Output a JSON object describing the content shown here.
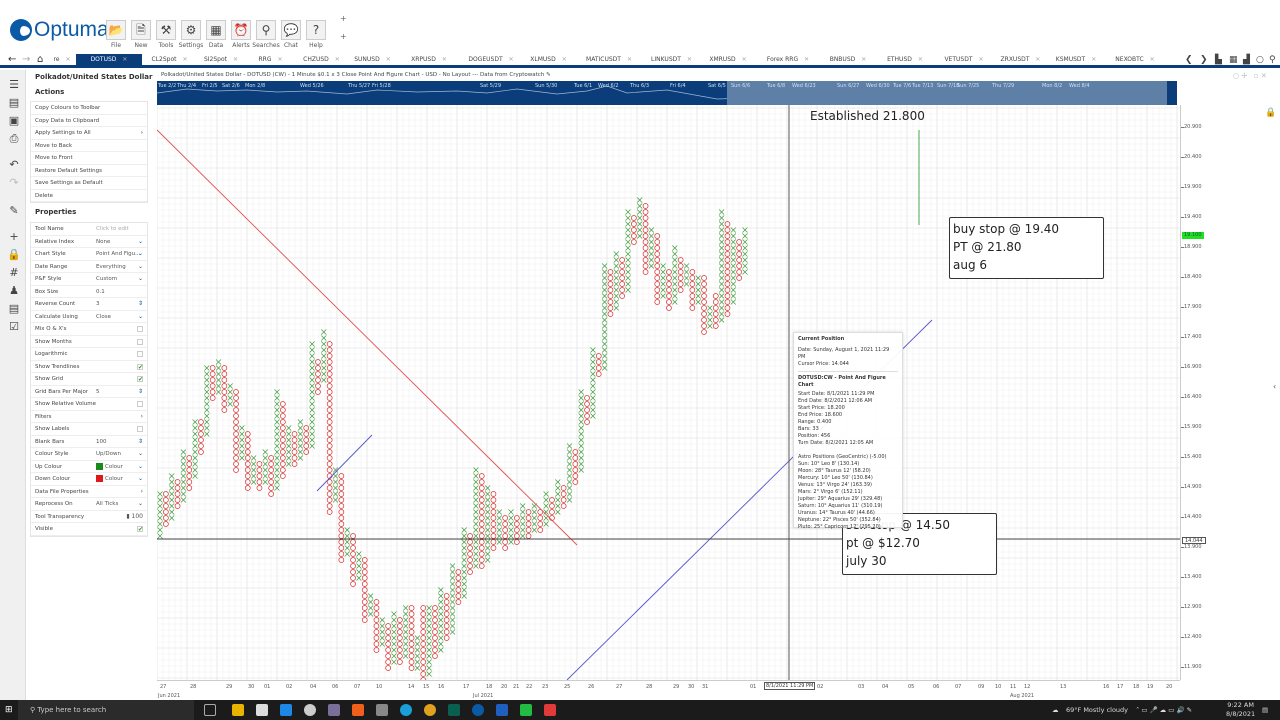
{
  "app": {
    "logo": "Optuma",
    "toolbar": [
      {
        "label": "File",
        "icon": "folder-icon",
        "glyph": "📂"
      },
      {
        "label": "New",
        "icon": "new-document-icon",
        "glyph": "🗎"
      },
      {
        "label": "Tools",
        "icon": "tools-icon",
        "glyph": "⚒"
      },
      {
        "label": "Settings",
        "icon": "gears-icon",
        "glyph": "⚙"
      },
      {
        "label": "Data",
        "icon": "binary-data-icon",
        "glyph": "▦"
      },
      {
        "label": "Alerts",
        "icon": "alarm-clock-icon",
        "glyph": "⏰"
      },
      {
        "label": "Searches",
        "icon": "magnifier-icon",
        "glyph": "⚲"
      },
      {
        "label": "Chat",
        "icon": "chat-bubbles-icon",
        "glyph": "💬"
      },
      {
        "label": "Help",
        "icon": "help-icon",
        "glyph": "?"
      }
    ],
    "plus_glyph": "+"
  },
  "tabs": [
    {
      "label": "re"
    },
    {
      "label": "DOTUSD",
      "active": true
    },
    {
      "label": "CL2Spot"
    },
    {
      "label": "SI2Spot"
    },
    {
      "label": "RRG"
    },
    {
      "label": "CHZUSD"
    },
    {
      "label": "SUNUSD"
    },
    {
      "label": "XRPUSD"
    },
    {
      "label": "DOGEUSDT"
    },
    {
      "label": "XLMUSD"
    },
    {
      "label": "MATICUSDT"
    },
    {
      "label": "LINKUSDT"
    },
    {
      "label": "XMRUSD"
    },
    {
      "label": "Forex RRG"
    },
    {
      "label": "BNBUSD"
    },
    {
      "label": "ETHUSD"
    },
    {
      "label": "VETUSDT"
    },
    {
      "label": "ZRXUSDT"
    },
    {
      "label": "KSMUSDT"
    },
    {
      "label": "NEXOBTC"
    }
  ],
  "tab_close_glyph": "✕",
  "nav": {
    "back": "←",
    "forward": "→",
    "home": "⌂",
    "tabs_left": "❮",
    "tabs_right": "❯"
  },
  "panel": {
    "title": "Polkadot/United States Dollar - DOTUSD",
    "actions_heading": "Actions",
    "actions": [
      {
        "label": "Copy Colours to Toolbar"
      },
      {
        "label": "Copy Data to Clipboard"
      },
      {
        "label": "Apply Settings to All",
        "submenu": true
      },
      {
        "label": "Move to Back"
      },
      {
        "label": "Move to Front"
      },
      {
        "label": "Restore Default Settings"
      },
      {
        "label": "Save Settings as Default"
      },
      {
        "label": "Delete"
      }
    ],
    "properties_heading": "Properties",
    "properties": [
      {
        "key": "Tool Name",
        "value": "Click to edit",
        "control": "text"
      },
      {
        "key": "Relative Index",
        "value": "None",
        "control": "dropdown"
      },
      {
        "key": "Chart Style",
        "value": "Point And Figu...",
        "control": "dropdown"
      },
      {
        "key": "Date Range",
        "value": "Everything",
        "control": "dropdown"
      },
      {
        "key": "P&F Style",
        "value": "Custom",
        "control": "dropdown"
      },
      {
        "key": "Box Size",
        "value": "0.1",
        "control": "text"
      },
      {
        "key": "Reverse Count",
        "value": "3",
        "control": "spinner"
      },
      {
        "key": "Calculate Using",
        "value": "Close",
        "control": "dropdown"
      },
      {
        "key": "Mix O & X's",
        "value": "",
        "control": "checkbox",
        "checked": false
      },
      {
        "key": "Show Months",
        "value": "",
        "control": "checkbox",
        "checked": false
      },
      {
        "key": "Logarithmic",
        "value": "",
        "control": "checkbox",
        "checked": false
      },
      {
        "key": "Show Trendlines",
        "value": "",
        "control": "checkbox",
        "checked": true
      },
      {
        "key": "Show Grid",
        "value": "",
        "control": "checkbox",
        "checked": true
      },
      {
        "key": "Grid Bars Per Major",
        "value": "5",
        "control": "spinner"
      },
      {
        "key": "Show Relative Volume",
        "value": "",
        "control": "checkbox",
        "checked": false
      },
      {
        "key": "Filters",
        "value": "",
        "control": "submenu"
      },
      {
        "key": "Show Labels",
        "value": "",
        "control": "checkbox",
        "checked": false
      },
      {
        "key": "Blank Bars",
        "value": "100",
        "control": "spinner"
      },
      {
        "key": "Colour Style",
        "value": "Up/Down",
        "control": "dropdown"
      },
      {
        "key": "Up Colour",
        "value": "Colour",
        "control": "color",
        "color": "#1a8a1a"
      },
      {
        "key": "Down Colour",
        "value": "Colour",
        "control": "color",
        "color": "#e01818"
      },
      {
        "key": "Data File Properties",
        "value": "",
        "control": "submenu"
      },
      {
        "key": "Reprocess On",
        "value": "All Ticks",
        "control": "dropdown"
      },
      {
        "key": "Tool Transparency",
        "value": "100",
        "control": "slider"
      },
      {
        "key": "Visible",
        "value": "",
        "control": "checkbox",
        "checked": true
      }
    ]
  },
  "chart": {
    "header": "Polkadot/United States Dollar - DOTUSD (CW) - 1 Minute $0.1 x 3 Close Point And Figure Chart - USD - No Layout --- Data from Cryptowatch",
    "navigator_labels": [
      "Tue 2/2",
      "Thu 2/4",
      "Fri 2/5",
      "Sat 2/6",
      "Mon 2/8",
      "Wed 5/26",
      "Thu 5/27",
      "Fri 5/28",
      "Sat 5/29",
      "Sun 5/30",
      "Tue 6/1",
      "Wed 6/2",
      "Thu 6/3",
      "Fri 6/4",
      "Sat 6/5",
      "Sun 6/6",
      "Tue 6/8",
      "Wed 6/23",
      "Sun 6/27",
      "Wed 6/30",
      "Tue 7/6",
      "Tue 7/13",
      "Sun 7/18",
      "Sun 7/25",
      "Thu 7/29",
      "Mon 8/2",
      "Wed 8/4"
    ],
    "y_ticks": [
      "20.900",
      "20.400",
      "19.900",
      "19.400",
      "18.900",
      "18.400",
      "17.900",
      "17.400",
      "16.900",
      "16.400",
      "15.900",
      "15.400",
      "14.900",
      "14.400",
      "13.900",
      "13.400",
      "12.900",
      "12.400",
      "11.900"
    ],
    "last_price": "19.100",
    "cursor_price_label": "14.044",
    "cursor_date_label": "8/1/2021 11:29 PM",
    "x_ticks": [
      "27",
      "28",
      "29",
      "30",
      "01",
      "02",
      "04",
      "06",
      "07",
      "10",
      "14",
      "15",
      "16",
      "17",
      "18",
      "20",
      "21",
      "22",
      "23",
      "25",
      "26",
      "27",
      "28",
      "29",
      "30",
      "31",
      "01",
      "02",
      "03",
      "04",
      "05",
      "06",
      "07",
      "09",
      "10",
      "11",
      "12",
      "13",
      "16",
      "17",
      "18",
      "19",
      "20"
    ],
    "x_months": [
      "Jun 2021",
      "Jul 2021",
      "Aug 2021"
    ],
    "annotations": {
      "established": "Established 21.800",
      "box1": [
        "buy stop @ 19.40",
        "PT @ 21.80",
        "aug 6"
      ],
      "box2": [
        "sell stop @ 14.50",
        "pt @ $12.70",
        "july 30"
      ]
    },
    "colors": {
      "up": "#3a9a3a",
      "down": "#d83030",
      "resistance": "#e05050",
      "support": "#5555cc",
      "navigator": "#0b3d7a"
    }
  },
  "tooltip": {
    "title": "Current Position",
    "lines1": [
      "Date: Sunday, August 1, 2021 11:29 PM",
      "Cursor Price: 14.044"
    ],
    "title2": "DOTUSD:CW - Point And Figure Chart",
    "lines2": [
      "Start Date: 8/1/2021 11:29 PM",
      "End Date: 8/2/2021 12:06 AM",
      "Start Price: 18.200",
      "End Price: 18.600",
      "Range: 0.400",
      "Bars: 33",
      "Position: 456",
      "Turn Date: 8/2/2021 12:05 AM"
    ],
    "lines3": [
      "Astro Positions (GeoCentric) (-5.00)",
      "Sun: 10° Leo 8' (130.14)",
      "Moon: 28° Taurus 12' (58.20)",
      "Mercury: 10° Leo 50' (130.84)",
      "Venus: 13° Virgo 24' (163.39)",
      "Mars: 2° Virgo 6' (152.11)",
      "Jupiter: 29° Aquarius 29' (329.48)",
      "Saturn: 10° Aquarius 11' (310.19)",
      "Uranus: 14° Taurus 40' (44.66)",
      "Neptune: 22° Pisces 50' (352.84)",
      "Pluto: 25° Capricorn 12' (295.20)"
    ]
  },
  "taskbar": {
    "search_placeholder": "Type here to search",
    "weather": "69°F  Mostly cloudy",
    "time": "9:22 AM",
    "date": "8/8/2021"
  }
}
